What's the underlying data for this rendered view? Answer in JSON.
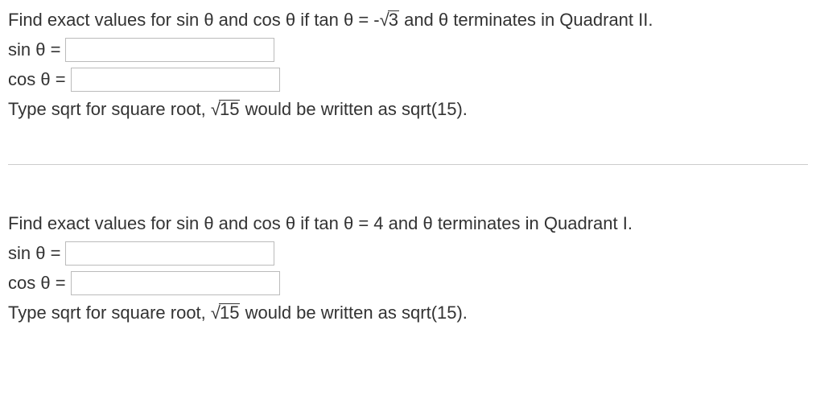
{
  "problem1": {
    "question_prefix": "Find exact values for sin θ and cos θ if tan θ = -",
    "question_radicand": "3",
    "question_suffix": " and θ terminates in Quadrant II.",
    "sin_label": "sin θ =",
    "sin_value": "",
    "cos_label": "cos θ =",
    "cos_value": "",
    "hint_prefix": "Type sqrt for square root, ",
    "hint_radicand": "15",
    "hint_suffix": " would be written as sqrt(15)."
  },
  "problem2": {
    "question": "Find exact values for sin θ and cos θ if tan θ = 4 and θ terminates in Quadrant I.",
    "sin_label": "sin θ =",
    "sin_value": "",
    "cos_label": "cos θ =",
    "cos_value": "",
    "hint_prefix": "Type sqrt for square root, ",
    "hint_radicand": "15",
    "hint_suffix": " would be written as sqrt(15)."
  }
}
